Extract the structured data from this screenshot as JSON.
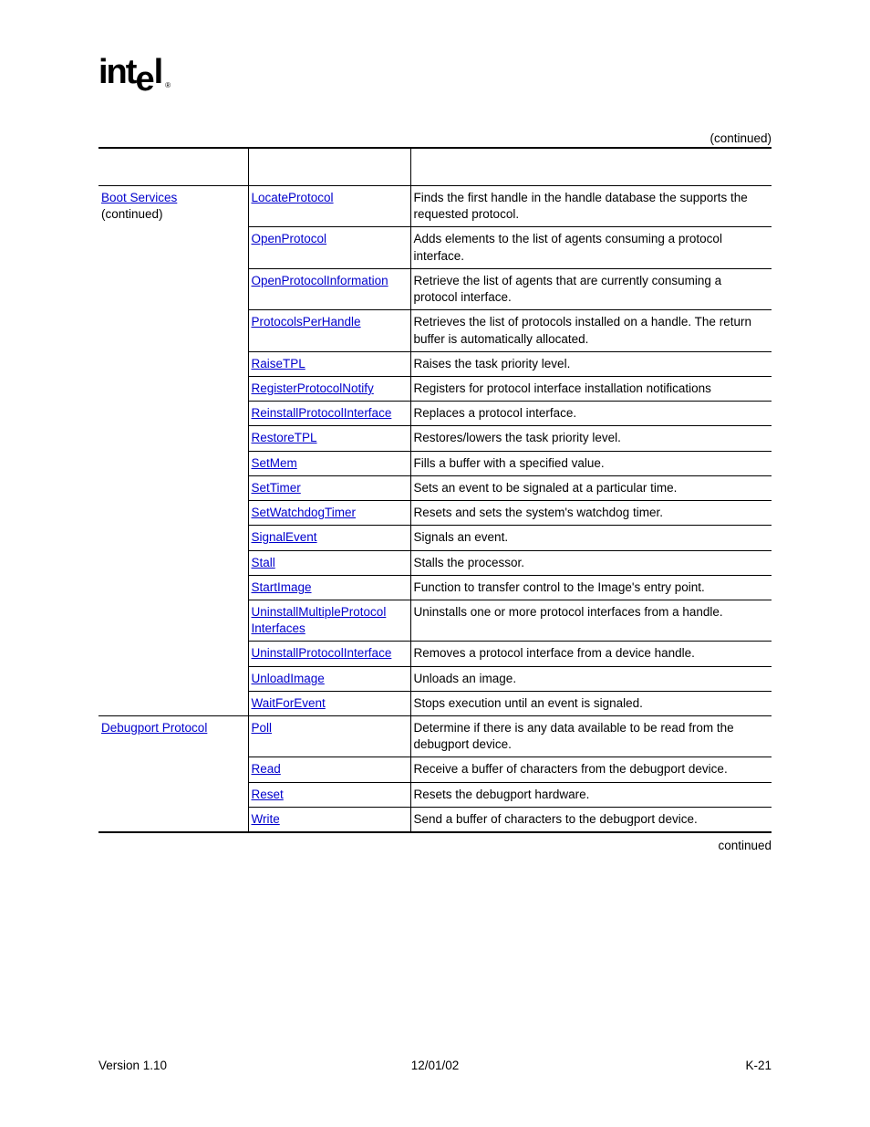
{
  "header": {
    "continued_label": "(continued)"
  },
  "sections": {
    "boot_services": {
      "title": "Boot Services",
      "subtitle": "(continued)"
    },
    "debugport": {
      "title": "Debugport Protocol"
    }
  },
  "rows": {
    "locate_protocol": {
      "name": "LocateProtocol",
      "desc": "Finds the first handle in the handle database the supports the requested protocol."
    },
    "open_protocol": {
      "name": "OpenProtocol",
      "desc": "Adds elements to the list of agents consuming a protocol interface."
    },
    "open_protocol_info": {
      "name": "OpenProtocolInformation",
      "desc": "Retrieve the list of agents that are currently consuming a protocol interface."
    },
    "protocols_per_handle": {
      "name": "ProtocolsPerHandle",
      "desc": "Retrieves the list of protocols installed on a handle. The return buffer is automatically allocated."
    },
    "raise_tpl": {
      "name": "RaiseTPL",
      "desc": "Raises the task priority level."
    },
    "register_protocol_notify": {
      "name": "RegisterProtocolNotify",
      "desc": "Registers for protocol interface installation notifications"
    },
    "reinstall_protocol_interface": {
      "name": "ReinstallProtocolInterface",
      "desc": "Replaces a protocol interface."
    },
    "restore_tpl": {
      "name": "RestoreTPL",
      "desc": "Restores/lowers the task priority level."
    },
    "set_mem": {
      "name": "SetMem",
      "desc": "Fills a buffer with a specified value."
    },
    "set_timer": {
      "name": "SetTimer",
      "desc": "Sets an event to be signaled at a particular time."
    },
    "set_watchdog_timer": {
      "name": "SetWatchdogTimer",
      "desc": "Resets and sets the system's watchdog timer."
    },
    "signal_event": {
      "name": "SignalEvent",
      "desc": "Signals an event."
    },
    "stall": {
      "name": "Stall",
      "desc": "Stalls the processor."
    },
    "start_image": {
      "name": "StartImage",
      "desc": "Function to transfer control to the Image's entry point."
    },
    "uninstall_multiple": {
      "name1": "UninstallMultipleProtocol",
      "name2": "Interfaces",
      "desc": "Uninstalls one or more protocol interfaces from a handle."
    },
    "uninstall_protocol_interface": {
      "name": "UninstallProtocolInterface",
      "desc": "Removes a protocol interface from a device handle."
    },
    "unload_image": {
      "name": "UnloadImage",
      "desc": "Unloads an image."
    },
    "wait_for_event": {
      "name": "WaitForEvent",
      "desc": "Stops execution until an event is signaled."
    },
    "poll": {
      "name": "Poll",
      "desc": "Determine if there is any data available to be read from the debugport device."
    },
    "read": {
      "name": "Read",
      "desc": "Receive a buffer of characters from the debugport device."
    },
    "reset": {
      "name": "Reset",
      "desc": "Resets the debugport hardware."
    },
    "write": {
      "name": "Write",
      "desc": "Send a buffer of characters to the debugport device."
    }
  },
  "footer": {
    "continued": "continued",
    "version": "Version 1.10",
    "date": "12/01/02",
    "page": "K-21"
  }
}
